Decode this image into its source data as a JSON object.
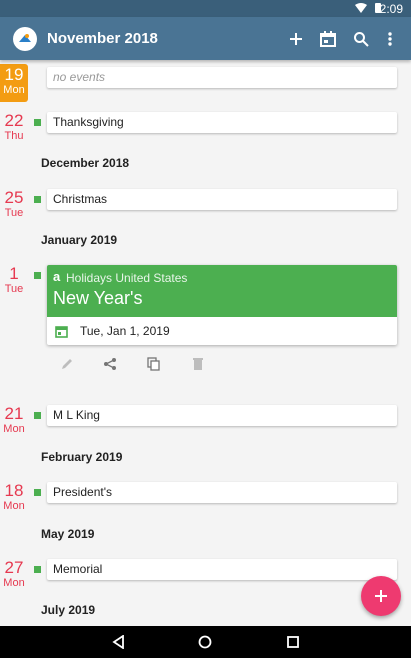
{
  "status_bar": {
    "time": "2:09"
  },
  "app_bar": {
    "title": "November 2018",
    "actions": [
      "add-icon",
      "calendar-icon",
      "search-icon",
      "more-vert-icon"
    ]
  },
  "agenda": {
    "today": {
      "day": "19",
      "dow": "Mon",
      "text": "no events"
    },
    "thanksgiving": {
      "day": "22",
      "dow": "Thu",
      "title": "Thanksgiving"
    },
    "month_dec": "December 2018",
    "christmas": {
      "day": "25",
      "dow": "Tue",
      "title": "Christmas"
    },
    "month_jan": "January 2019",
    "newyear": {
      "day": "1",
      "dow": "Tue",
      "calendar": "Holidays United States",
      "title": "New Year's",
      "date": "Tue, Jan 1, 2019"
    },
    "mlk": {
      "day": "21",
      "dow": "Mon",
      "title": "M L King"
    },
    "month_feb": "February 2019",
    "president": {
      "day": "18",
      "dow": "Mon",
      "title": "President's"
    },
    "month_may": "May 2019",
    "memorial": {
      "day": "27",
      "dow": "Mon",
      "title": "Memorial"
    },
    "month_jul": "July 2019"
  },
  "colors": {
    "appbar": "#4a7494",
    "event": "#4caf50",
    "date": "#e63950",
    "today": "#f39c12",
    "fab": "#ee3a70"
  }
}
